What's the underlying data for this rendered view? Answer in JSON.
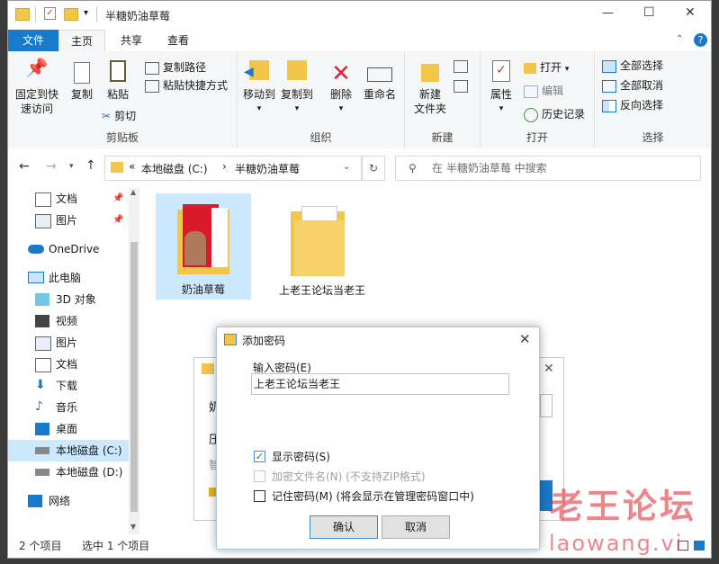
{
  "window": {
    "title": "半糖奶油草莓",
    "controls": {
      "minimize": "—",
      "maximize": "☐",
      "close": "✕"
    },
    "help": "?"
  },
  "ribbon_tabs": [
    "文件",
    "主页",
    "共享",
    "查看"
  ],
  "ribbon": {
    "clipboard": {
      "pin_line1": "固定到快",
      "pin_line2": "速访问",
      "copy": "复制",
      "paste": "粘贴",
      "copy_path": "复制路径",
      "paste_shortcut": "粘贴快捷方式",
      "cut": "剪切",
      "group": "剪贴板"
    },
    "organize": {
      "move_to": "移动到",
      "copy_to": "复制到",
      "delete": "删除",
      "rename": "重命名",
      "group": "组织"
    },
    "new": {
      "new_folder_line1": "新建",
      "new_folder_line2": "文件夹",
      "group": "新建"
    },
    "open": {
      "properties": "属性",
      "open": "打开",
      "edit": "编辑",
      "history": "历史记录",
      "group": "打开"
    },
    "select": {
      "select_all": "全部选择",
      "select_none": "全部取消",
      "invert": "反向选择",
      "group": "选择"
    }
  },
  "address": {
    "prefix": "«",
    "drive": "本地磁盘 (C:)",
    "sep": "›",
    "folder": "半糖奶油草莓",
    "search_placeholder": "在 半糖奶油草莓 中搜索"
  },
  "sidebar": {
    "items": [
      {
        "label": "文档",
        "pinned": true
      },
      {
        "label": "图片",
        "pinned": true
      },
      {
        "label": "OneDrive"
      },
      {
        "label": "此电脑"
      },
      {
        "label": "3D 对象"
      },
      {
        "label": "视频"
      },
      {
        "label": "图片"
      },
      {
        "label": "文档"
      },
      {
        "label": "下载"
      },
      {
        "label": "音乐"
      },
      {
        "label": "桌面"
      },
      {
        "label": "本地磁盘 (C:)"
      },
      {
        "label": "本地磁盘 (D:)"
      },
      {
        "label": "网络"
      }
    ]
  },
  "files": [
    {
      "name": "奶油草莓"
    },
    {
      "name": "上老王论坛当老王"
    }
  ],
  "status": {
    "count": "2 个项目",
    "selected": "选中 1 个项目"
  },
  "dialog": {
    "title": "添加密码",
    "input_label": "输入密码(E)",
    "input_value": "上老王论坛当老王",
    "show_password": "显示密码(S)",
    "encrypt_names": "加密文件名(N) (不支持ZIP格式)",
    "remember": "记住密码(M) (将会显示在管理密码窗口中)",
    "ok": "确认",
    "cancel": "取消"
  },
  "background_dialog": {
    "row1": "奶",
    "row2": "压",
    "row3": "智"
  },
  "watermark": {
    "line1": "老王论坛",
    "line2": "laowang.vi"
  },
  "colors": {
    "accent": "#1979ca",
    "folder": "#f3c54b",
    "watermark": "#e0242c"
  }
}
